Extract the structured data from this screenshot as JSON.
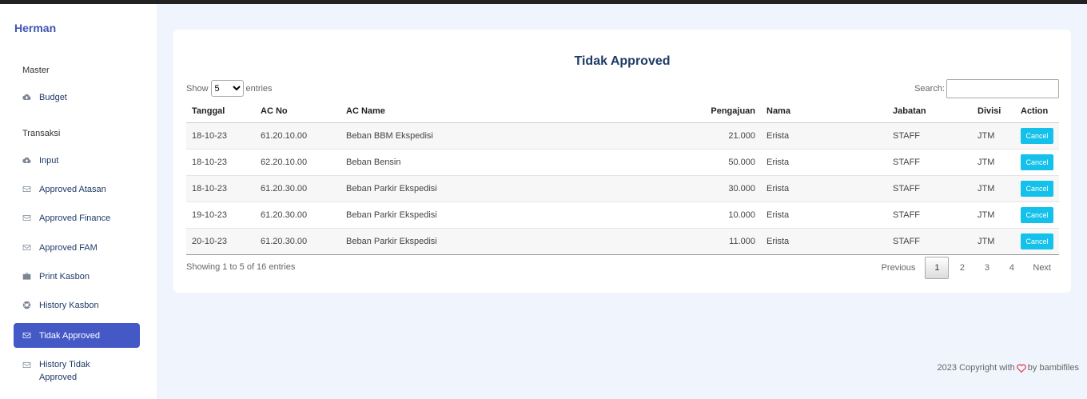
{
  "sidebar": {
    "brand": "Herman",
    "section_master": "Master",
    "section_transaksi": "Transaksi",
    "items": [
      {
        "label": "Budget",
        "icon": "cloud-upload-icon"
      },
      {
        "label": "Input",
        "icon": "cloud-upload-icon"
      },
      {
        "label": "Approved Atasan",
        "icon": "envelope-icon"
      },
      {
        "label": "Approved Finance",
        "icon": "envelope-icon"
      },
      {
        "label": "Approved FAM",
        "icon": "envelope-icon"
      },
      {
        "label": "Print Kasbon",
        "icon": "briefcase-icon"
      },
      {
        "label": "History Kasbon",
        "icon": "life-ring-icon"
      },
      {
        "label": "Tidak Approved",
        "icon": "envelope-icon",
        "active": true
      },
      {
        "label": "History Tidak Approved",
        "icon": "envelope-icon"
      }
    ]
  },
  "main": {
    "title": "Tidak Approved",
    "show_label": "Show",
    "entries_label": "entries",
    "page_size": "5",
    "search_label": "Search:",
    "search_value": "",
    "columns": [
      "Tanggal",
      "AC No",
      "AC Name",
      "Pengajuan",
      "Nama",
      "Jabatan",
      "Divisi",
      "Action"
    ],
    "rows": [
      [
        "18-10-23",
        "61.20.10.00",
        "Beban BBM Ekspedisi",
        "21.000",
        "Erista",
        "STAFF",
        "JTM",
        "Cancel"
      ],
      [
        "18-10-23",
        "62.20.10.00",
        "Beban Bensin",
        "50.000",
        "Erista",
        "STAFF",
        "JTM",
        "Cancel"
      ],
      [
        "18-10-23",
        "61.20.30.00",
        "Beban Parkir Ekspedisi",
        "30.000",
        "Erista",
        "STAFF",
        "JTM",
        "Cancel"
      ],
      [
        "19-10-23",
        "61.20.30.00",
        "Beban Parkir Ekspedisi",
        "10.000",
        "Erista",
        "STAFF",
        "JTM",
        "Cancel"
      ],
      [
        "20-10-23",
        "61.20.30.00",
        "Beban Parkir Ekspedisi",
        "11.000",
        "Erista",
        "STAFF",
        "JTM",
        "Cancel"
      ]
    ],
    "info": "Showing 1 to 5 of 16 entries",
    "pagination": {
      "previous": "Previous",
      "pages": [
        "1",
        "2",
        "3",
        "4"
      ],
      "current": "1",
      "next": "Next"
    }
  },
  "footer": {
    "prefix": "2023 Copyright with",
    "suffix": "by bambifiles",
    "heart_color": "#e0344a"
  },
  "colors": {
    "accent": "#4458c6",
    "cancel_button": "#13c1ea",
    "title": "#1e3a66"
  }
}
